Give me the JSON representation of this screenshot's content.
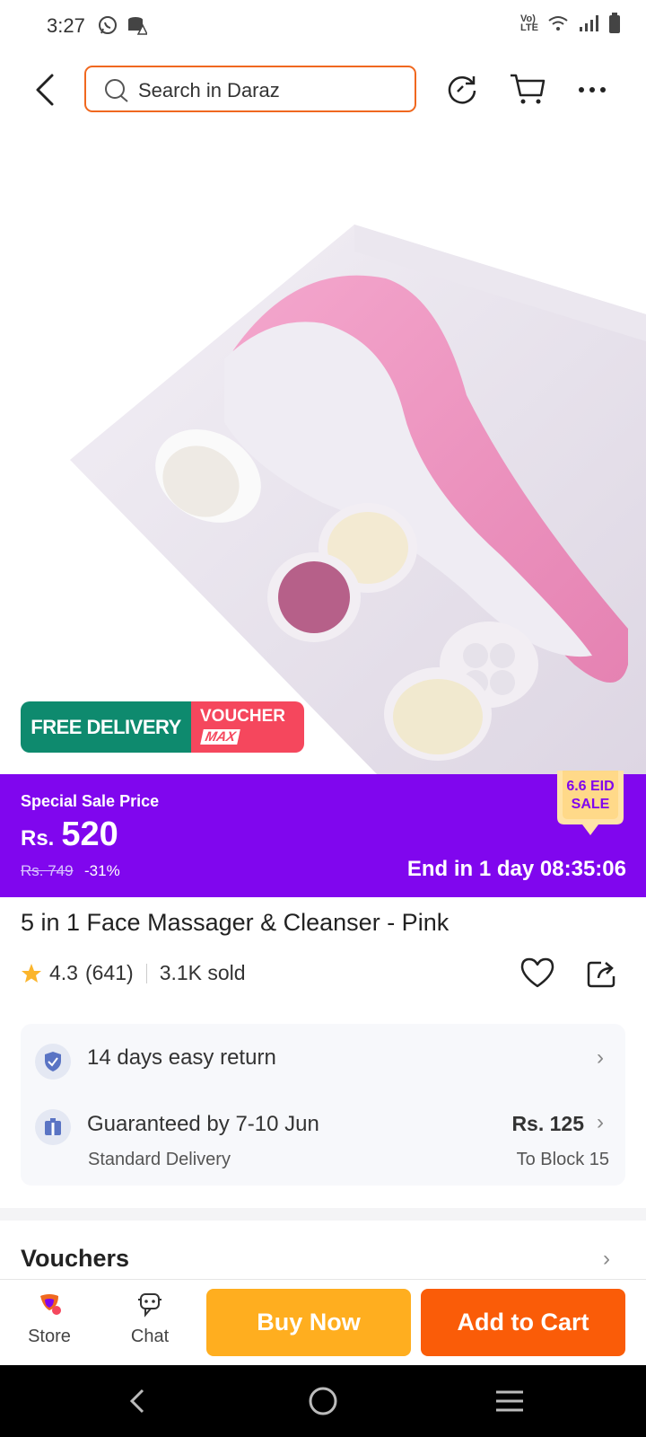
{
  "status_bar": {
    "time": "3:27"
  },
  "search": {
    "placeholder": "Search in Daraz"
  },
  "badges": {
    "free_delivery": "FREE DELIVERY",
    "voucher": "VOUCHER",
    "voucher_max": "MAX"
  },
  "sale": {
    "label": "Special Sale Price",
    "currency": "Rs.",
    "price": "520",
    "old_price": "Rs. 749",
    "discount": "-31%",
    "ends": "End in 1 day 08:35:06",
    "campaign_line1": "6.6 EID",
    "campaign_line2": "SALE"
  },
  "product": {
    "title": "5 in 1 Face Massager & Cleanser - Pink",
    "rating": "4.3",
    "reviews": "(641)",
    "sold": "3.1K sold"
  },
  "info": {
    "return": "14 days easy return",
    "guarantee": "Guaranteed by 7-10 Jun",
    "delivery_type": "Standard Delivery",
    "delivery_fee": "Rs. 125",
    "destination": "To Block 15"
  },
  "vouchers": {
    "title": "Vouchers"
  },
  "bottom_bar": {
    "store": "Store",
    "chat": "Chat",
    "buy_now": "Buy Now",
    "add_to_cart": "Add to Cart"
  },
  "colors": {
    "accent": "#f0681f",
    "sale_band": "#8006ee",
    "buy_now": "#ffae1f",
    "add_to_cart": "#fa5c08",
    "free_delivery": "#0e8a6e",
    "voucher": "#f5475d"
  }
}
